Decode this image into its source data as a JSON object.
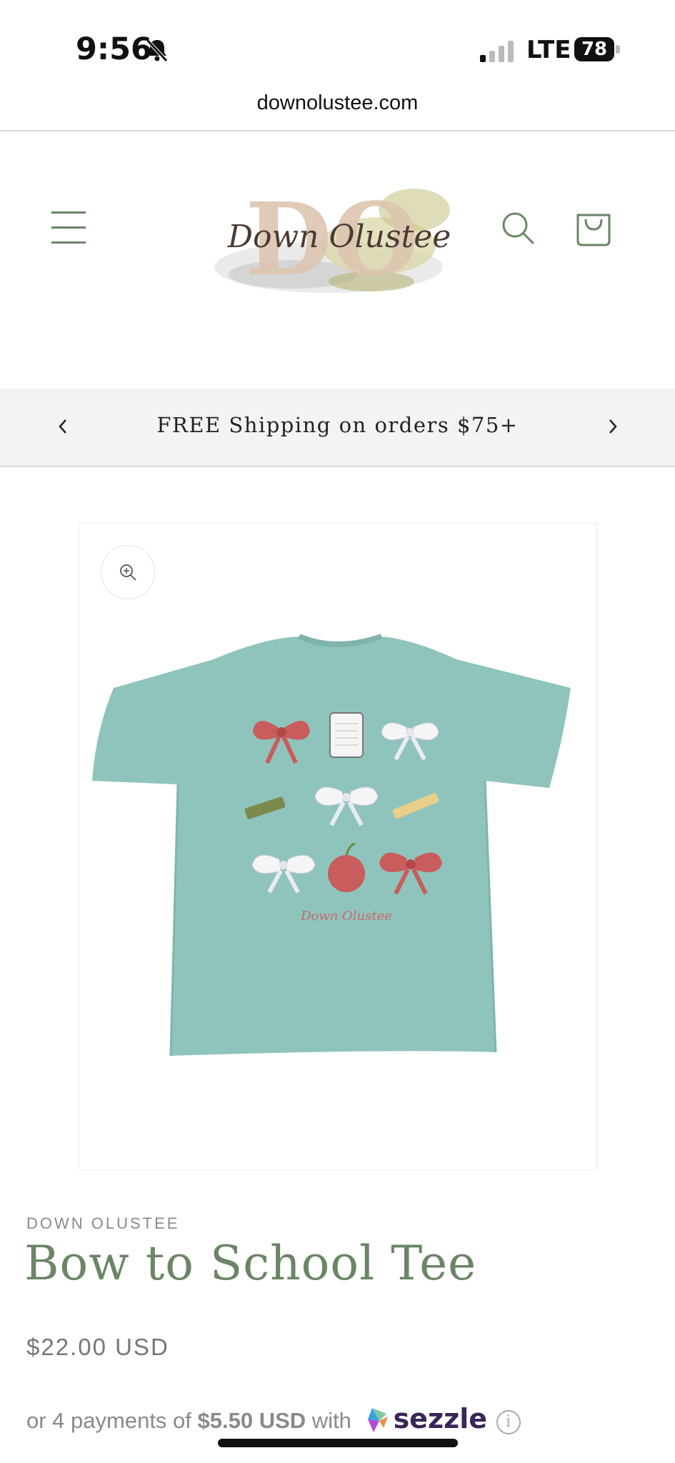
{
  "status_bar": {
    "time": "9:56",
    "network": "LTE",
    "battery": "78"
  },
  "browser": {
    "url": "downolustee.com"
  },
  "header": {
    "logo_text": "Down Olustee",
    "logo_monogram": "DO",
    "icons": {
      "menu": "hamburger-menu-icon",
      "search": "search-icon",
      "cart": "cart-icon"
    }
  },
  "announcement": {
    "text": "FREE Shipping on orders $75+"
  },
  "product": {
    "vendor": "DOWN OLUSTEE",
    "title": "Bow to School Tee",
    "price": "$22.00 USD",
    "shirt_print_signature": "Down Olustee",
    "installments": {
      "prefix": "or 4 payments of",
      "amount": "$5.50 USD",
      "with": "with",
      "provider": "sezzle",
      "info": "i"
    }
  },
  "colors": {
    "accent_green": "#6b8566",
    "shirt": "#8fc4bc",
    "sezzle_purple": "#392558"
  }
}
